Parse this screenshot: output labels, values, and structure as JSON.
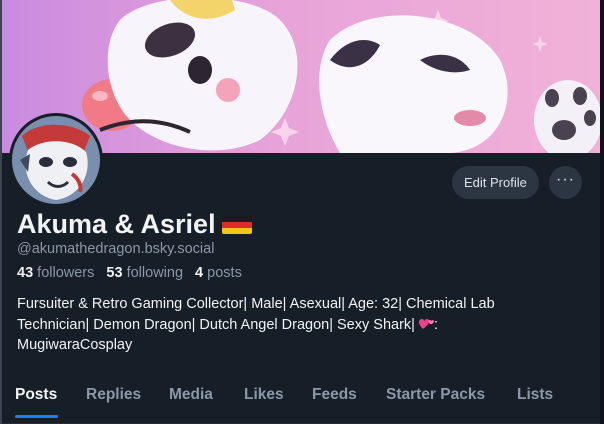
{
  "profile": {
    "display_name": "Akuma & Asriel",
    "flag_emoji": "german-flag",
    "handle": "@akumathedragon.bsky.social",
    "followers_count": "43",
    "followers_label": "followers",
    "following_count": "53",
    "following_label": "following",
    "posts_count": "4",
    "posts_label": "posts",
    "bio_line1": "Fursuiter & Retro Gaming Collector| Male| Asexual|  Age: 32| Chemical Lab",
    "bio_line2a": "Technician| Demon Dragon| Dutch Angel Dragon| Sexy Shark| ",
    "bio_line2b": ":",
    "bio_line3": "MugiwaraCosplay"
  },
  "actions": {
    "edit_profile_label": "Edit Profile",
    "more_label": "···"
  },
  "tabs": [
    {
      "label": "Posts",
      "active": true
    },
    {
      "label": "Replies",
      "active": false
    },
    {
      "label": "Media",
      "active": false
    },
    {
      "label": "Likes",
      "active": false
    },
    {
      "label": "Feeds",
      "active": false
    },
    {
      "label": "Starter Packs",
      "active": false
    },
    {
      "label": "Lists",
      "active": false
    }
  ],
  "colors": {
    "background": "#161e27",
    "accent": "#1083fe",
    "muted_text": "#8b98a8",
    "button_bg": "#2c3642"
  },
  "icons": {
    "more": "ellipsis-icon",
    "bio_emoji": "two-hearts-icon"
  }
}
